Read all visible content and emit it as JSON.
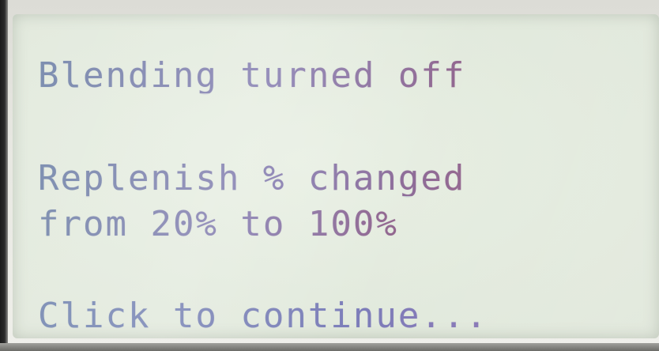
{
  "screen": {
    "message_lines": [
      "Blending turned off",
      "Replenish % changed",
      "from 20% to 100%"
    ],
    "prompt": "Click to continue..."
  }
}
